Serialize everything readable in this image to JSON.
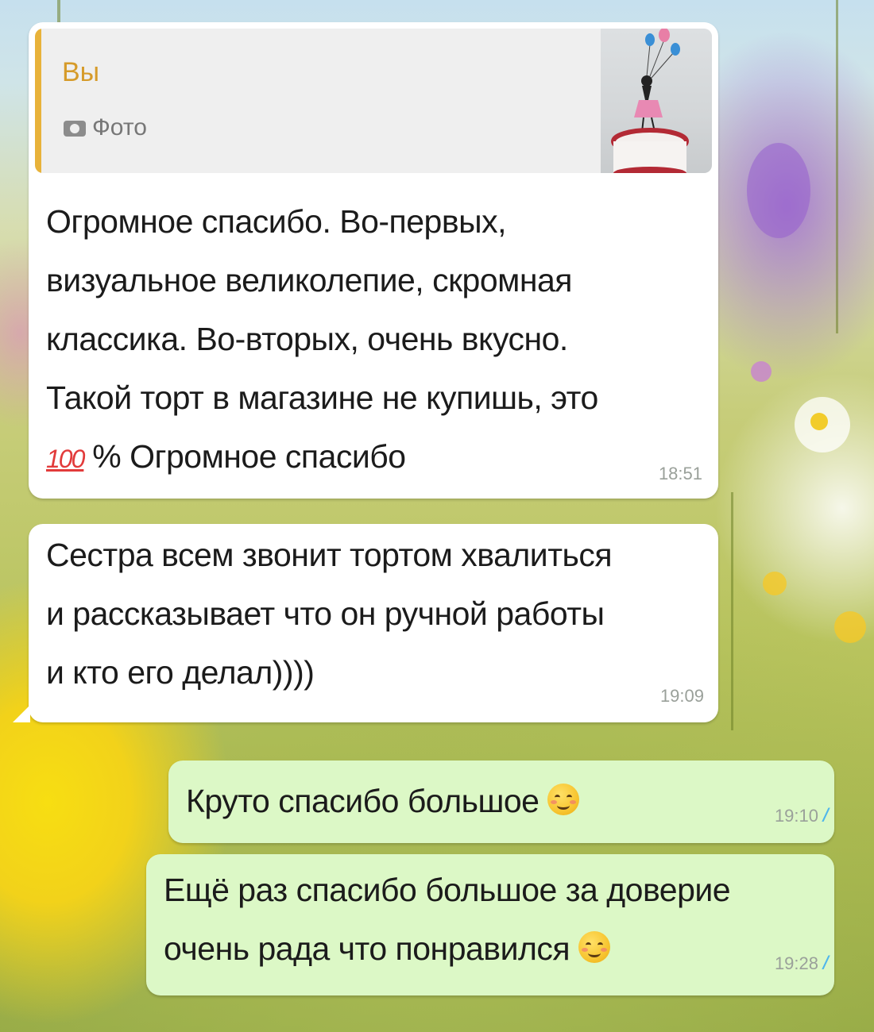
{
  "messages": [
    {
      "direction": "incoming",
      "reply_to": {
        "author": "Вы",
        "media_icon": "camera-icon",
        "media_label": "Фото"
      },
      "lines": [
        "Огромное спасибо. Во-первых,",
        "визуальное великолепие, скромная",
        "классика. Во-вторых, очень вкусно.",
        "Такой торт в магазине не купишь, это"
      ],
      "last_line_emoji": "100-emoji",
      "last_line_emoji_text": "100",
      "last_line_rest": " % Огромное спасибо",
      "time": "18:51"
    },
    {
      "direction": "incoming",
      "lines": [
        "Сестра всем звонит тортом хвалиться",
        "и рассказывает что он ручной работы",
        "и кто его делал))))"
      ],
      "time": "19:09"
    },
    {
      "direction": "outgoing",
      "text": "Круто спасибо большое",
      "emoji": "smiling-face-emoji",
      "time": "19:10",
      "status": "read",
      "status_icon": "double-check-icon"
    },
    {
      "direction": "outgoing",
      "lines": [
        "Ещё раз спасибо большое за доверие",
        "очень рада что понравился"
      ],
      "emoji": "smiling-face-emoji",
      "time": "19:28",
      "status": "read",
      "status_icon": "double-check-icon"
    }
  ],
  "colors": {
    "incoming_bubble": "#ffffff",
    "outgoing_bubble": "#dcf8c6",
    "reply_bar": "#e8b23a",
    "reply_author": "#d69b2a",
    "read_checks": "#4fb6ec",
    "timestamp": "#9aa09a"
  },
  "wallpaper": "field-of-wildflowers"
}
